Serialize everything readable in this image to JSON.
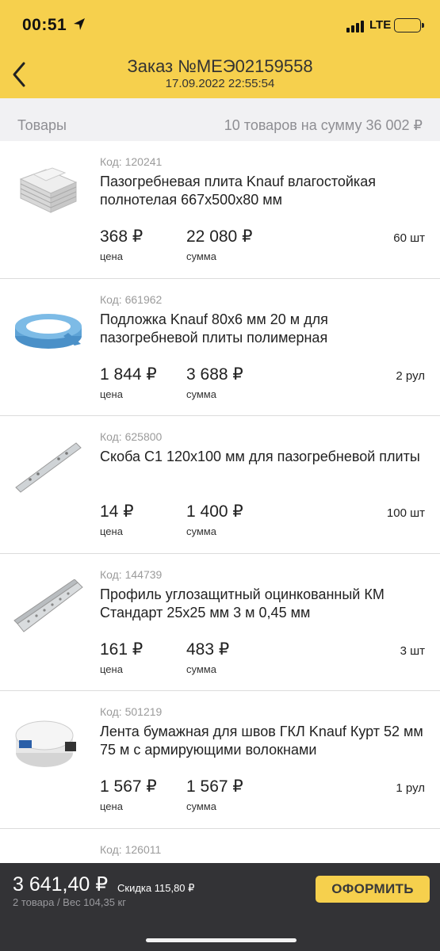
{
  "status_bar": {
    "time": "00:51",
    "network": "LTE",
    "battery_level": 0.2
  },
  "header": {
    "title": "Заказ №МЕЭ02159558",
    "subtitle": "17.09.2022 22:55:54"
  },
  "section": {
    "label": "Товары",
    "summary": "10 товаров на сумму 36 002 ₽"
  },
  "items": [
    {
      "code": "Код: 120241",
      "name": "Пазогребневая плита Knauf влагостойкая полнотелая 667х500х80 мм",
      "price": "368 ₽",
      "price_label": "цена",
      "sum": "22 080 ₽",
      "sum_label": "сумма",
      "qty": "60 шт",
      "icon": "gypsum-board-stack-icon"
    },
    {
      "code": "Код: 661962",
      "name": "Подложка Knauf 80х6 мм 20 м для пазогребневой плиты полимерная",
      "price": "1 844 ₽",
      "price_label": "цена",
      "sum": "3 688 ₽",
      "sum_label": "сумма",
      "qty": "2 рул",
      "icon": "foam-tape-roll-icon"
    },
    {
      "code": "Код: 625800",
      "name": "Скоба С1 120х100 мм для пазогребневой плиты",
      "price": "14 ₽",
      "price_label": "цена",
      "sum": "1 400 ₽",
      "sum_label": "сумма",
      "qty": "100 шт",
      "icon": "metal-bracket-icon"
    },
    {
      "code": "Код: 144739",
      "name": "Профиль углозащитный оцинкованный КМ Стандарт 25х25 мм 3 м 0,45 мм",
      "price": "161 ₽",
      "price_label": "цена",
      "sum": "483 ₽",
      "sum_label": "сумма",
      "qty": "3 шт",
      "icon": "corner-profile-icon"
    },
    {
      "code": "Код: 501219",
      "name": "Лента бумажная для швов ГКЛ Knauf Курт 52 мм 75 м с армирующими волокнами",
      "price": "1 567 ₽",
      "price_label": "цена",
      "sum": "1 567 ₽",
      "sum_label": "сумма",
      "qty": "1 рул",
      "icon": "paper-tape-roll-icon"
    },
    {
      "code": "Код: 126011",
      "name": "",
      "price": "",
      "price_label": "",
      "sum": "",
      "sum_label": "",
      "qty": "",
      "icon": "bucket-icon"
    }
  ],
  "bottom_bar": {
    "total": "3 641,40 ₽",
    "discount": "Скидка 115,80 ₽",
    "meta": "2 товара / Вес 104,35 кг",
    "checkout_label": "ОФОРМИТЬ"
  },
  "colors": {
    "accent": "#f6d04d",
    "bottom_bar": "#333336",
    "section_bg": "#f1f1f3"
  }
}
